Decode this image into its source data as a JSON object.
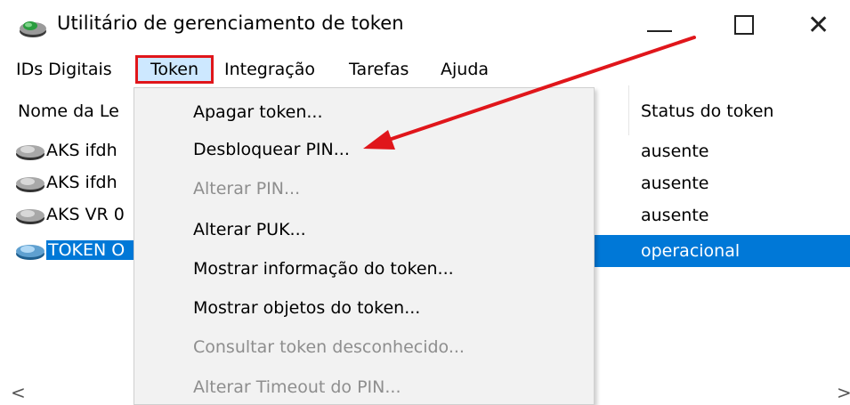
{
  "window": {
    "title": "Utilitário de gerenciamento de token",
    "minimize_label": "—",
    "close_label": "✕"
  },
  "menu": {
    "items": [
      "IDs Digitais",
      "Token",
      "Integração",
      "Tarefas",
      "Ajuda"
    ],
    "active": "Token"
  },
  "list": {
    "columns": {
      "name": "Nome da Le",
      "status": "Status do token"
    },
    "rows": [
      {
        "name": "AKS ifdh",
        "status": "ausente",
        "selected": false
      },
      {
        "name": "AKS ifdh",
        "status": "ausente",
        "selected": false
      },
      {
        "name": "AKS VR 0",
        "status": "ausente",
        "selected": false
      },
      {
        "name": "TOKEN O",
        "status": "operacional",
        "selected": true
      }
    ]
  },
  "token_menu": {
    "items": [
      {
        "label": "Apagar token...",
        "enabled": true
      },
      {
        "label": "Desbloquear PIN...",
        "enabled": true
      },
      {
        "label": "Alterar PIN...",
        "enabled": false
      },
      {
        "label": "Alterar PUK...",
        "enabled": true
      },
      {
        "label": "Mostrar informação do token...",
        "enabled": true
      },
      {
        "label": "Mostrar objetos do token...",
        "enabled": true
      },
      {
        "label": "Consultar token desconhecido...",
        "enabled": false
      },
      {
        "label": "Alterar Timeout do PIN...",
        "enabled": false
      }
    ]
  },
  "scrollbar": {
    "left_label": "<",
    "right_label": ">"
  },
  "colors": {
    "highlight": "#0078d7",
    "annotation_red": "#e0161b",
    "menu_bg": "#f2f2f2",
    "disabled_text": "#8e8e8e"
  },
  "icons": {
    "app": "token-reader-icon",
    "row": "reader-icon",
    "row_selected": "reader-blue-icon"
  }
}
